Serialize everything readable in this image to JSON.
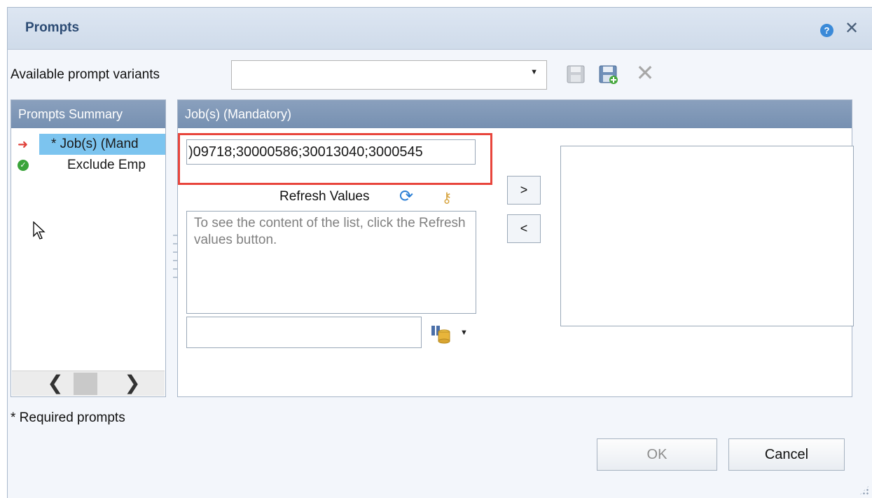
{
  "dialog": {
    "title": "Prompts",
    "help_icon": "help-icon",
    "help_glyph": "?",
    "close_glyph": "✕"
  },
  "variants": {
    "label": "Available prompt variants",
    "selected_value": ""
  },
  "summary": {
    "header": "Prompts Summary",
    "items": [
      {
        "label": "* Job(s) (Mand",
        "status_icon": "arrow-icon",
        "glyph": "➜",
        "selected": true
      },
      {
        "label": "Exclude Emp",
        "status_icon": "check-icon",
        "glyph": "✓",
        "selected": false
      }
    ]
  },
  "job_panel": {
    "header": "Job(s) (Mandatory)",
    "input_value": ")09718;30000586;30013040;3000545",
    "refresh_label": "Refresh Values",
    "list_placeholder": "To see the content of the list, click the Refresh values button.",
    "search_value": "",
    "add_label": ">",
    "remove_label": "<"
  },
  "footer": {
    "required_note": "* Required prompts",
    "ok_label": "OK",
    "cancel_label": "Cancel"
  },
  "colors": {
    "header": "#7c95b6",
    "selection": "#7cc4ef",
    "highlight": "#e8453c"
  }
}
